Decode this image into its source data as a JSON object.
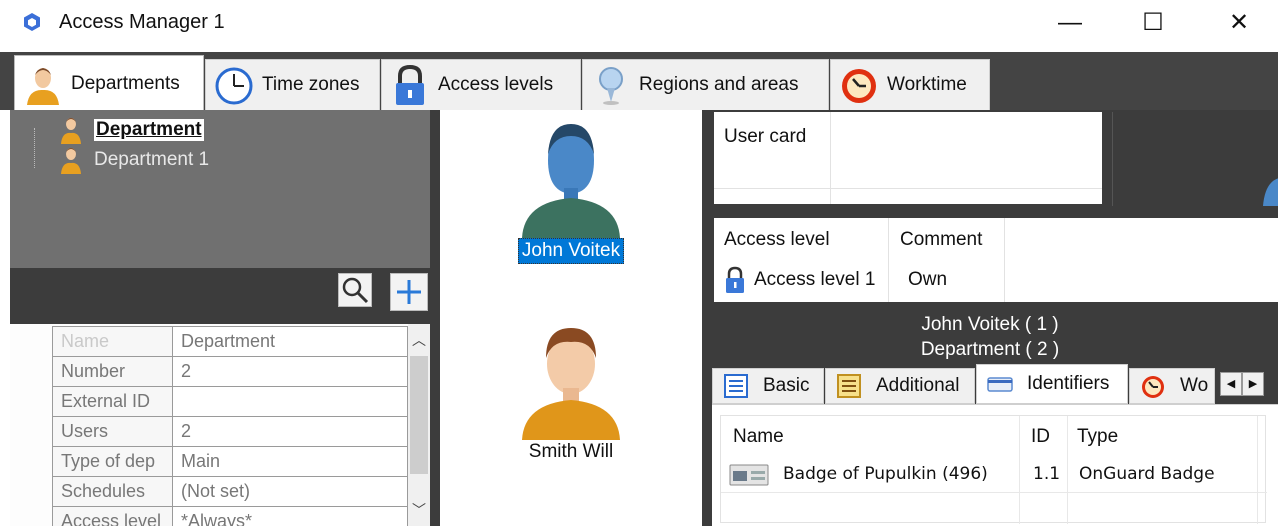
{
  "window": {
    "title": "Access Manager 1",
    "minimize": "—",
    "maximize": "☐",
    "close": "✕"
  },
  "tabs": [
    {
      "label": "Departments",
      "icon": "person-icon",
      "active": true
    },
    {
      "label": "Time zones",
      "icon": "clock-icon",
      "active": false
    },
    {
      "label": "Access levels",
      "icon": "lock-icon",
      "active": false
    },
    {
      "label": "Regions and areas",
      "icon": "pin-icon",
      "active": false
    },
    {
      "label": "Worktime",
      "icon": "alarm-clock-icon",
      "active": false
    }
  ],
  "tree": {
    "root": "Department",
    "child": "Department 1"
  },
  "properties": [
    {
      "name": "Name",
      "value": "Department"
    },
    {
      "name": "Number",
      "value": "2"
    },
    {
      "name": "External ID",
      "value": ""
    },
    {
      "name": "Users",
      "value": "2"
    },
    {
      "name": "Type of dep",
      "value": "Main"
    },
    {
      "name": "Schedules",
      "value": "(Not set)"
    },
    {
      "name": "Access level",
      "value": "*Always*"
    }
  ],
  "users": [
    {
      "name": "John Voitek",
      "selected": true
    },
    {
      "name": "Smith Will",
      "selected": false
    }
  ],
  "user_card": {
    "label": "User card"
  },
  "access_grid": {
    "columns": [
      "Access level",
      "Comment"
    ],
    "rows": [
      {
        "level": "Access level 1",
        "comment": "Own"
      }
    ]
  },
  "summary": {
    "user_line": "John Voitek ( 1 )",
    "dept_line": "Department ( 2 )"
  },
  "subtabs": [
    {
      "label": "Basic",
      "icon": "list-icon"
    },
    {
      "label": "Additional",
      "icon": "list-icon"
    },
    {
      "label": "Identifiers",
      "icon": "card-icon",
      "active": true
    },
    {
      "label": "Wo",
      "icon": "alarm-clock-icon"
    }
  ],
  "identifiers": {
    "columns": [
      "Name",
      "ID",
      "Type"
    ],
    "rows": [
      {
        "name": "Badge of Pupulkin (496)",
        "id": "1.1",
        "type": "OnGuard Badge"
      }
    ]
  },
  "colors": {
    "panel_dark": "#3c3c3c",
    "tree_bg": "#707070",
    "selection": "#0078d7"
  }
}
